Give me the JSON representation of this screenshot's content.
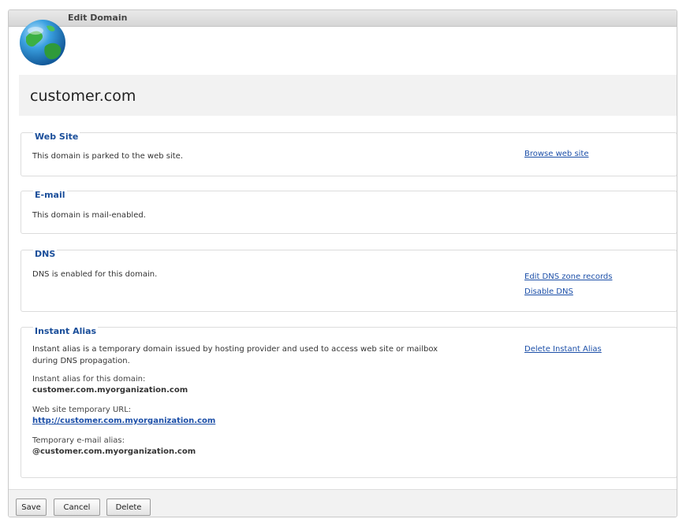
{
  "window": {
    "title": "Edit Domain"
  },
  "domain": {
    "name": "customer.com"
  },
  "sections": {
    "web_site": {
      "title": "Web Site",
      "description": "This domain is parked to the web site.",
      "link_browse": "Browse web site"
    },
    "email": {
      "title": "E-mail",
      "description": "This domain is mail-enabled."
    },
    "dns": {
      "title": "DNS",
      "description": "DNS is enabled for this domain.",
      "link_edit_zone": "Edit DNS zone records",
      "link_disable": "Disable DNS"
    },
    "instant_alias": {
      "title": "Instant Alias",
      "description_line1": "Instant alias is a temporary domain issued by hosting provider and used to access web site or mailbox",
      "description_line2": "during DNS propagation.",
      "link_delete": "Delete Instant Alias",
      "alias_label": "Instant alias for this domain:",
      "alias_value": "customer.com.myorganization.com",
      "url_label": "Web site temporary URL:",
      "url_value": "http://customer.com.myorganization.com",
      "email_label": "Temporary e-mail alias:",
      "email_value": "@customer.com.myorganization.com"
    }
  },
  "buttons": {
    "save": "Save",
    "cancel": "Cancel",
    "delete": "Delete"
  },
  "icons": {
    "window_icon": "globe-icon"
  }
}
